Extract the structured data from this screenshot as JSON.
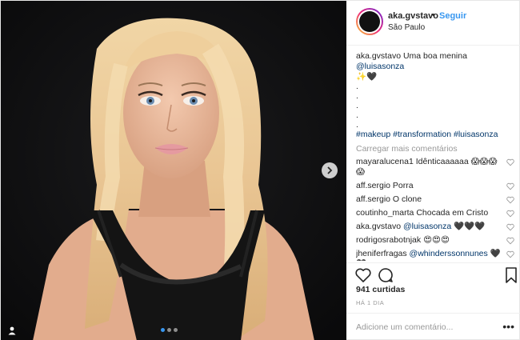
{
  "post": {
    "author": "aka.gvstavo",
    "separator": "•",
    "follow_label": "Seguir",
    "location": "São Paulo",
    "caption": {
      "user": "aka.gvstavo",
      "text": "Uma boa menina",
      "mention": "@luisasonza",
      "emoji": "✨🖤",
      "dots": [
        ".",
        ".",
        ".",
        ".",
        "."
      ],
      "hashtags": "#makeup #transformation #luisasonza"
    },
    "load_more": "Carregar mais comentários",
    "comments": [
      {
        "user": "mayaralucena1",
        "text": "Idênticaaaaaa 😱😱😱 😱"
      },
      {
        "user": "aff.sergio",
        "text": "Porra"
      },
      {
        "user": "aff.sergio",
        "text": "O clone"
      },
      {
        "user": "coutinho_marta",
        "text": "Chocada em Cristo"
      },
      {
        "user": "aka.gvstavo",
        "mention": "@luisasonza",
        "text": "🖤🖤🖤"
      },
      {
        "user": "rodrigosrabotnjak",
        "text": "😍😍😍"
      },
      {
        "user": "jheniferfragas",
        "mention": "@whinderssonnunes",
        "text": "🖤🖤"
      }
    ],
    "likes": "941 curtidas",
    "time": "HÁ 1 DIA",
    "add_comment_placeholder": "Adicione um comentário...",
    "more_options": "•••",
    "carousel": {
      "count": 3,
      "active": 0
    }
  },
  "icons": {
    "next": "chevron-right-icon",
    "tag": "user-tag-icon",
    "like": "heart-icon",
    "comment": "comment-icon",
    "save": "bookmark-icon"
  },
  "colors": {
    "link": "#003569",
    "follow": "#3897f0",
    "muted": "#999999",
    "photo_bg": "#0f0f10"
  }
}
